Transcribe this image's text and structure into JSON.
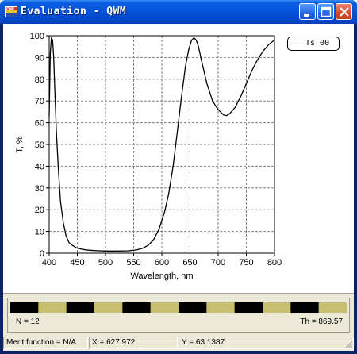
{
  "window": {
    "title": "Evaluation - QWM",
    "icon": "app-logo-icon",
    "controls": [
      "minimize-icon",
      "maximize-icon",
      "close-icon"
    ]
  },
  "legend": {
    "label": "Ts 00"
  },
  "chart_data": {
    "type": "line",
    "xlabel": "Wavelength, nm",
    "ylabel": "T, %",
    "xlim": [
      400,
      800
    ],
    "ylim": [
      0,
      100
    ],
    "x_ticks": [
      "400",
      "450",
      "500",
      "550",
      "600",
      "650",
      "700",
      "750",
      "800"
    ],
    "y_ticks": [
      "0",
      "10",
      "20",
      "30",
      "40",
      "50",
      "60",
      "70",
      "80",
      "90",
      "100"
    ],
    "grid": true,
    "legend_position": "top-right",
    "series": [
      {
        "name": "Ts 00",
        "color": "#000000",
        "x": [
          400,
          402,
          404,
          406,
          408,
          410,
          413,
          416,
          420,
          425,
          430,
          435,
          440,
          445,
          450,
          460,
          470,
          480,
          500,
          520,
          540,
          555,
          565,
          575,
          585,
          595,
          605,
          612,
          620,
          628,
          635,
          642,
          648,
          653,
          657,
          661,
          665,
          670,
          680,
          690,
          700,
          710,
          715,
          720,
          730,
          740,
          750,
          760,
          770,
          780,
          790,
          800
        ],
        "y": [
          63,
          92,
          99,
          98,
          90,
          75,
          55,
          40,
          24,
          14,
          8,
          5,
          3.8,
          3.0,
          2.3,
          1.7,
          1.4,
          1.2,
          1.0,
          1.0,
          1.1,
          1.5,
          2.2,
          3.5,
          6,
          11,
          19,
          27,
          40,
          57,
          72,
          86,
          94,
          98,
          99,
          98,
          95,
          89,
          78,
          70,
          66,
          63.5,
          63.3,
          64,
          67,
          72,
          78,
          84,
          89,
          93,
          96,
          98
        ]
      }
    ]
  },
  "layer_strip": {
    "segment_colors": [
      "#000000",
      "#c8c070"
    ],
    "segments": 12
  },
  "info": {
    "n_label": "N = 12",
    "th_label": "Th = 869.57"
  },
  "status": {
    "merit": "Merit function = N/A",
    "x": "X = 627.972",
    "y": "Y = 63.1387"
  }
}
